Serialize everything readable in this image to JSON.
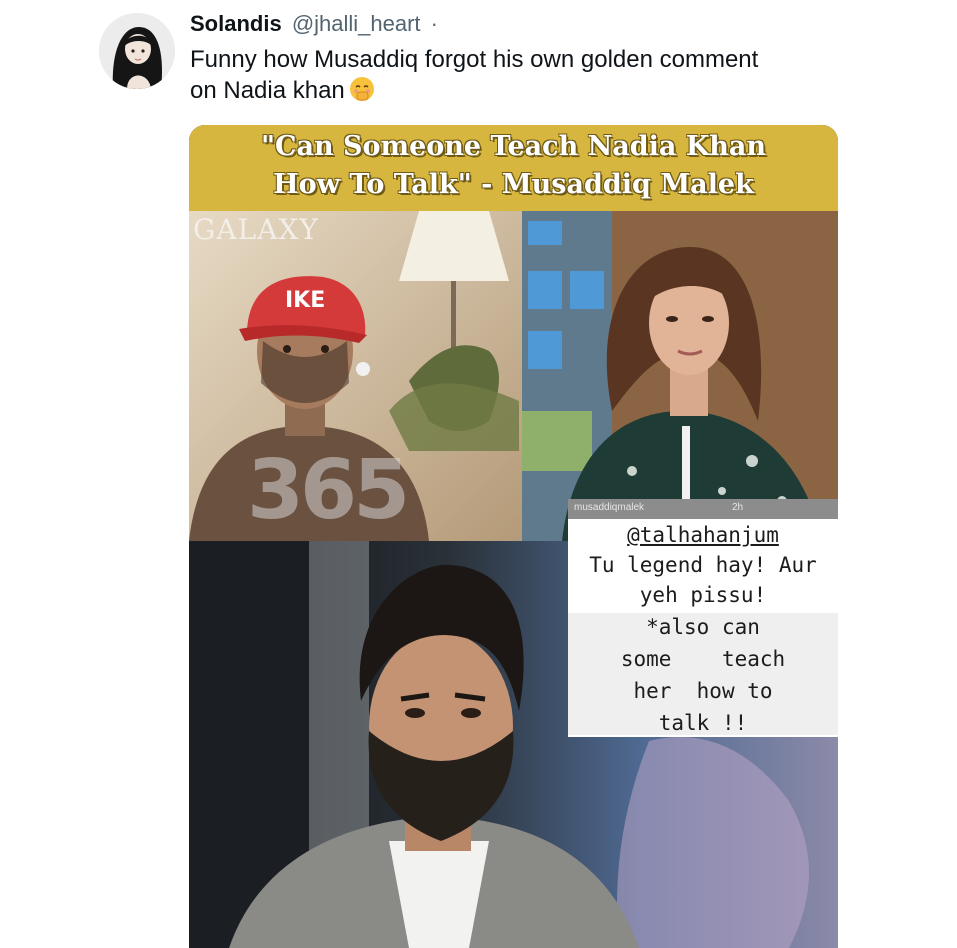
{
  "tweet": {
    "author_name": "Solandis",
    "author_handle": "@jhalli_heart",
    "separator": "·",
    "text_line1": "Funny how Musaddiq forgot his own golden comment",
    "text_line2": "on Nadia khan",
    "emoji": "face-with-hand-over-mouth-emoji"
  },
  "media": {
    "banner_line1": "\"Can Someone Teach Nadia Khan",
    "banner_line2": "How To Talk\" - Musaddiq Malek",
    "top_left_watermark": "GALAXY",
    "cap_text": "IKE",
    "number_watermark": "365",
    "story": {
      "username": "musaddiqmalek",
      "time": "2h",
      "mention": "@talhahanjum",
      "line1": "Tu legend hay! Aur",
      "line2": "yeh pissu!",
      "line3": "*also can",
      "line4": "some    teach",
      "line5": "her  how to",
      "line6": "talk !!"
    }
  },
  "colors": {
    "banner_gold": "#d6b63f",
    "text_primary": "#0f1419",
    "text_secondary": "#536471"
  }
}
